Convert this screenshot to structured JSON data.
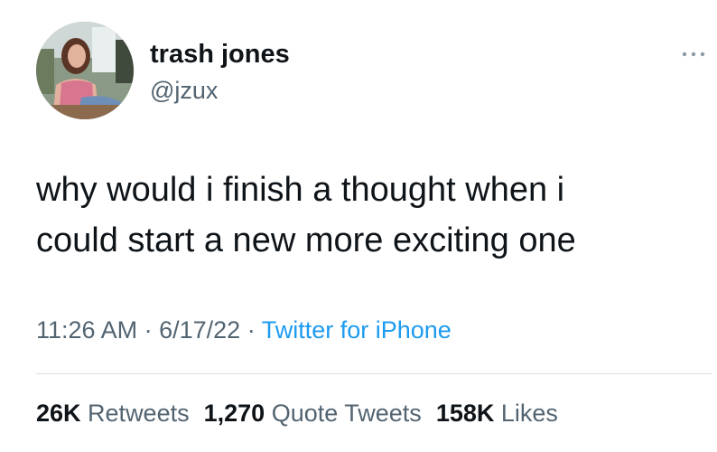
{
  "author": {
    "display_name": "trash jones",
    "handle": "@jzux"
  },
  "tweet": {
    "text_line1": "why would i finish a thought when i",
    "text_line2": "could start a new more exciting one"
  },
  "meta": {
    "time": "11:26 AM",
    "date": "6/17/22",
    "source": "Twitter for iPhone",
    "separator": "·"
  },
  "stats": {
    "retweets_count": "26K",
    "retweets_label": "Retweets",
    "quotes_count": "1,270",
    "quotes_label": "Quote Tweets",
    "likes_count": "158K",
    "likes_label": "Likes"
  },
  "colors": {
    "text": "#0f1419",
    "secondary": "#536471",
    "link": "#1d9bf0",
    "divider": "#d9dde1"
  },
  "icons": {
    "more": "more-options-icon"
  }
}
